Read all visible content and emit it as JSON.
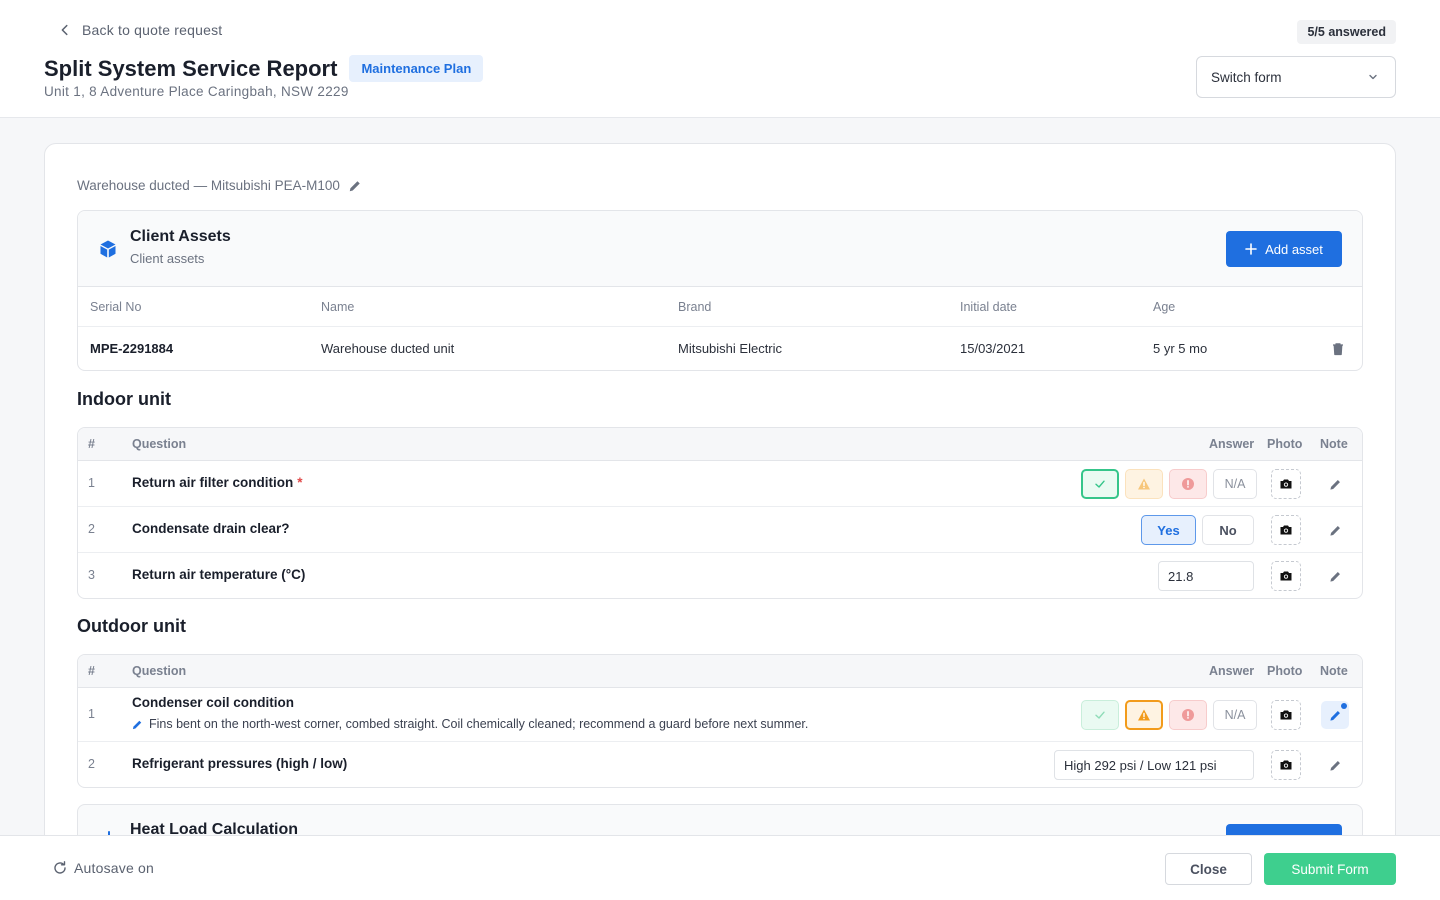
{
  "header": {
    "back_label": "Back to quote request",
    "title": "Split System Service Report",
    "badge": "Maintenance Plan",
    "address": "Unit 1, 8 Adventure Place Caringbah, NSW 2229",
    "answered": "5/5 answered",
    "switch_form": "Switch form"
  },
  "asset_caption": "Warehouse ducted — Mitsubishi PEA-M100",
  "assets": {
    "title": "Client Assets",
    "subtitle": "Client assets",
    "add_label": "Add asset",
    "columns": [
      "Serial No",
      "Name",
      "Brand",
      "Initial date",
      "Age"
    ],
    "rows": [
      {
        "serial": "MPE-2291884",
        "name": "Warehouse ducted unit",
        "brand": "Mitsubishi Electric",
        "date": "15/03/2021",
        "age": "5 yr 5 mo"
      }
    ]
  },
  "table_headers": {
    "num": "#",
    "question": "Question",
    "answer": "Answer",
    "photo": "Photo",
    "note": "Note"
  },
  "indoor": {
    "title": "Indoor unit",
    "questions": [
      {
        "num": "1",
        "text": "Return air filter condition",
        "required": "*",
        "answer": "ok",
        "na_label": "N/A"
      },
      {
        "num": "2",
        "text": "Condensate drain clear?",
        "yes_label": "Yes",
        "no_label": "No",
        "answer": "Yes"
      },
      {
        "num": "3",
        "text": "Return air temperature (°C)",
        "value": "21.8"
      }
    ]
  },
  "outdoor": {
    "title": "Outdoor unit",
    "questions": [
      {
        "num": "1",
        "text": "Condenser coil condition",
        "note": "Fins bent on the north-west corner, combed straight. Coil chemically cleaned; recommend a guard before next summer.",
        "answer": "warn",
        "na_label": "N/A"
      },
      {
        "num": "2",
        "text": "Refrigerant pressures (high / low)",
        "value": "High 292 psi / Low 121 psi"
      }
    ]
  },
  "heat": {
    "title": "Heat Load Calculation"
  },
  "footer": {
    "autosave": "Autosave on",
    "close_label": "Close",
    "submit_label": "Submit Form"
  },
  "colors": {
    "primary": "#1f6fe0",
    "success": "#3ecf8e",
    "warning": "#f29b1b",
    "danger": "#e04848"
  },
  "icons": [
    "chevron-left-icon",
    "chevron-down-icon",
    "pencil-icon",
    "cube-icon",
    "plus-icon",
    "trash-icon",
    "check-icon",
    "warning-icon",
    "error-icon",
    "camera-icon",
    "refresh-icon"
  ]
}
